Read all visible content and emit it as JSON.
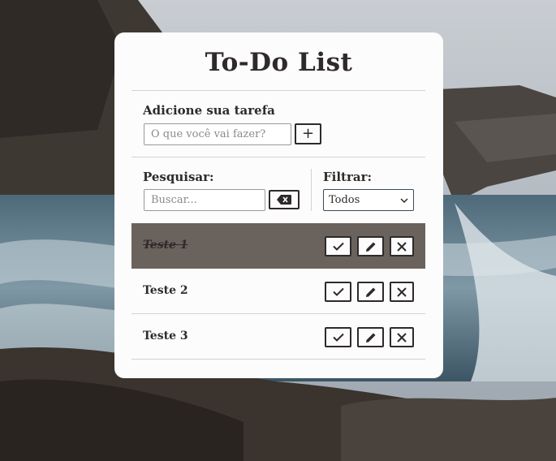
{
  "app": {
    "title": "To-Do List"
  },
  "add": {
    "label": "Adicione sua tarefa",
    "placeholder": "O que você vai fazer?",
    "value": "",
    "button_label": "+"
  },
  "search": {
    "label": "Pesquisar:",
    "placeholder": "Buscar...",
    "value": ""
  },
  "filter": {
    "label": "Filtrar:",
    "selected": "Todos",
    "options": [
      "Todos"
    ]
  },
  "todos": [
    {
      "text": "Teste 1",
      "done": true
    },
    {
      "text": "Teste 2",
      "done": false
    },
    {
      "text": "Teste 3",
      "done": false
    }
  ],
  "icons": {
    "check": "check-icon",
    "edit": "pencil-icon",
    "delete": "close-icon",
    "erase": "backspace-icon",
    "dropdown": "chevron-down-icon"
  },
  "colors": {
    "accent": "#2f2a2a",
    "done_row": "#6a625d",
    "card": "#fcfcfc"
  }
}
